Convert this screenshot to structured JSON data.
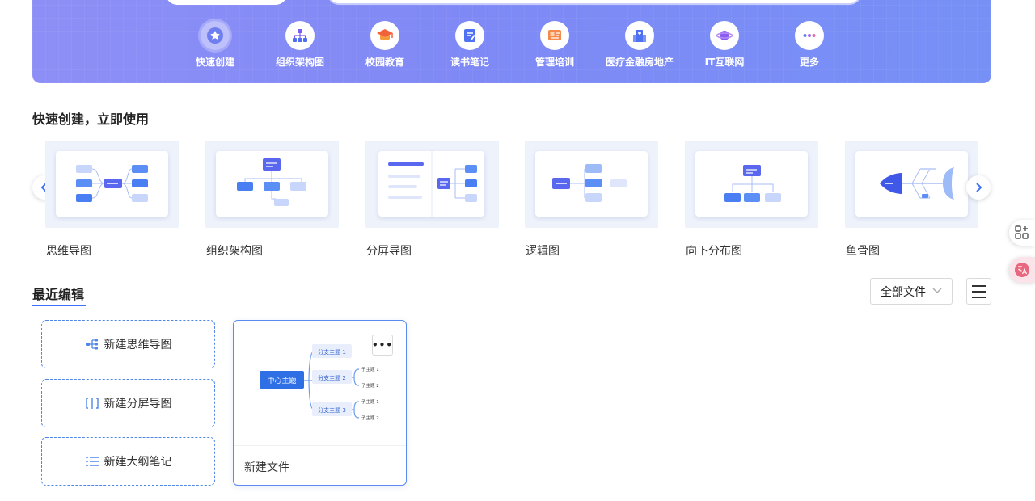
{
  "categories": [
    {
      "label": "快速创建",
      "icon": "star-badge-icon"
    },
    {
      "label": "组织架构图",
      "icon": "org-chart-icon"
    },
    {
      "label": "校园教育",
      "icon": "graduation-cap-icon"
    },
    {
      "label": "读书笔记",
      "icon": "notebook-icon"
    },
    {
      "label": "管理培训",
      "icon": "presentation-icon"
    },
    {
      "label": "医疗金融房地产",
      "icon": "building-icon"
    },
    {
      "label": "IT互联网",
      "icon": "planet-icon"
    },
    {
      "label": "更多",
      "icon": "more-dots-icon"
    }
  ],
  "quick_create": {
    "title": "快速创建，立即使用",
    "templates": [
      {
        "name": "思维导图",
        "icon": "mind-map-thumbnail"
      },
      {
        "name": "组织架构图",
        "icon": "org-chart-thumbnail"
      },
      {
        "name": "分屏导图",
        "icon": "split-map-thumbnail"
      },
      {
        "name": "逻辑图",
        "icon": "logic-chart-thumbnail"
      },
      {
        "name": "向下分布图",
        "icon": "down-tree-thumbnail"
      },
      {
        "name": "鱼骨图",
        "icon": "fishbone-thumbnail"
      }
    ]
  },
  "recent": {
    "title": "最近编辑",
    "filter_label": "全部文件",
    "new_buttons": [
      {
        "label": "新建思维导图",
        "icon": "mind-map-icon"
      },
      {
        "label": "新建分屏导图",
        "icon": "split-screen-icon"
      },
      {
        "label": "新建大纲笔记",
        "icon": "outline-list-icon"
      }
    ],
    "file": {
      "name": "新建文件",
      "preview": {
        "center": "中心主题",
        "branches": [
          "分支主题 1",
          "分支主题 2",
          "分支主题 3"
        ],
        "subs": [
          "子主题 1",
          "子主题 2"
        ]
      }
    }
  },
  "colors": {
    "accent": "#3f6ff6",
    "banner": "#8b8ef6"
  }
}
